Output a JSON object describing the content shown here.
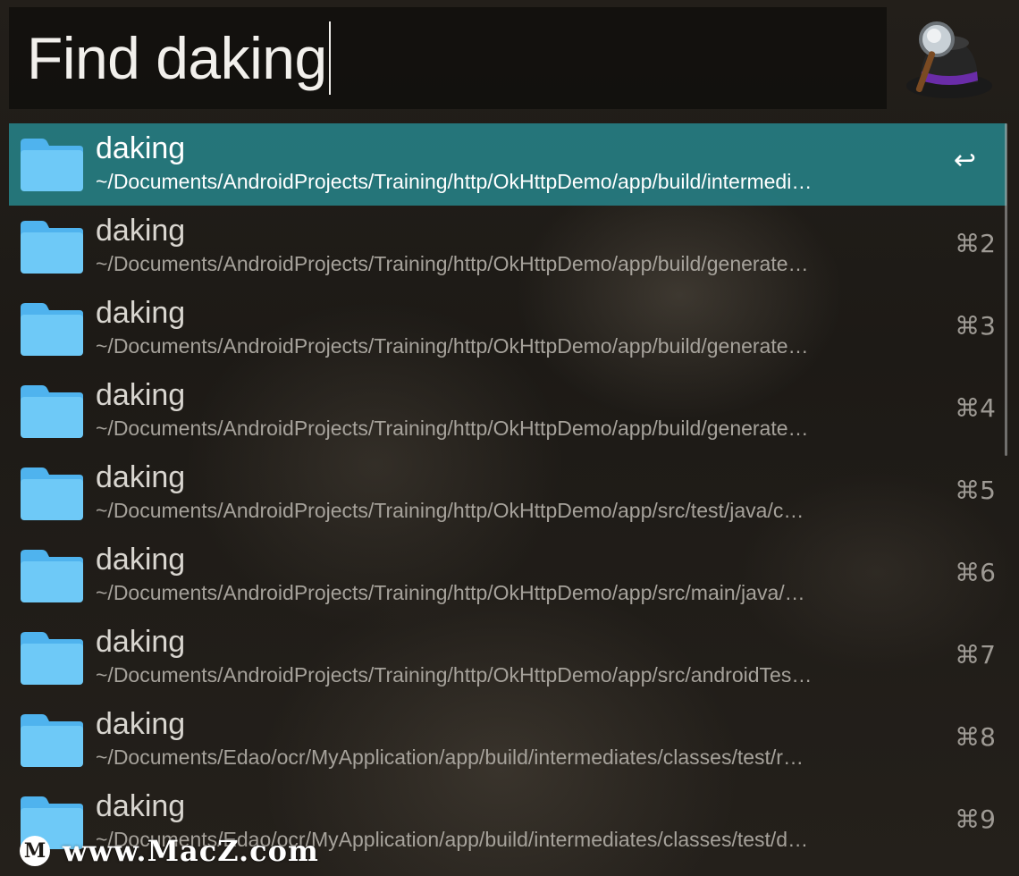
{
  "search": {
    "query": "Find daking"
  },
  "results": [
    {
      "title": "daking",
      "subtitle": "~/Documents/AndroidProjects/Training/http/OkHttpDemo/app/build/intermedi…",
      "shortcut": "↩",
      "selected": true
    },
    {
      "title": "daking",
      "subtitle": "~/Documents/AndroidProjects/Training/http/OkHttpDemo/app/build/generate…",
      "shortcut": "⌘2",
      "selected": false
    },
    {
      "title": "daking",
      "subtitle": "~/Documents/AndroidProjects/Training/http/OkHttpDemo/app/build/generate…",
      "shortcut": "⌘3",
      "selected": false
    },
    {
      "title": "daking",
      "subtitle": "~/Documents/AndroidProjects/Training/http/OkHttpDemo/app/build/generate…",
      "shortcut": "⌘4",
      "selected": false
    },
    {
      "title": "daking",
      "subtitle": "~/Documents/AndroidProjects/Training/http/OkHttpDemo/app/src/test/java/c…",
      "shortcut": "⌘5",
      "selected": false
    },
    {
      "title": "daking",
      "subtitle": "~/Documents/AndroidProjects/Training/http/OkHttpDemo/app/src/main/java/…",
      "shortcut": "⌘6",
      "selected": false
    },
    {
      "title": "daking",
      "subtitle": "~/Documents/AndroidProjects/Training/http/OkHttpDemo/app/src/androidTes…",
      "shortcut": "⌘7",
      "selected": false
    },
    {
      "title": "daking",
      "subtitle": "~/Documents/Edao/ocr/MyApplication/app/build/intermediates/classes/test/r…",
      "shortcut": "⌘8",
      "selected": false
    },
    {
      "title": "daking",
      "subtitle": "~/Documents/Edao/ocr/MyApplication/app/build/intermediates/classes/test/d…",
      "shortcut": "⌘9",
      "selected": false
    }
  ],
  "icons": {
    "result_icon": "folder-icon",
    "app_logo": "alfred-hat-icon",
    "return_key": "return-icon"
  },
  "colors": {
    "selected_row": "#267d82",
    "folder": "#6ec9f7"
  },
  "watermark": {
    "badge": "M",
    "text": "www.MacZ.com"
  }
}
